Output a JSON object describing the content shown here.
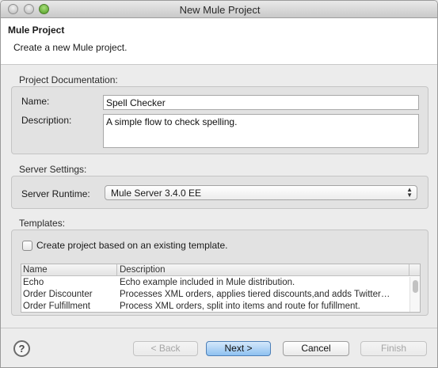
{
  "window": {
    "title": "New Mule Project"
  },
  "header": {
    "title": "Mule Project",
    "description": "Create a new Mule project."
  },
  "documentation": {
    "section_label": "Project Documentation:",
    "name_label": "Name:",
    "name_value": "Spell Checker",
    "description_label": "Description:",
    "description_value": "A simple flow to check spelling."
  },
  "server": {
    "section_label": "Server Settings:",
    "runtime_label": "Server Runtime:",
    "runtime_value": "Mule Server 3.4.0 EE"
  },
  "templates": {
    "section_label": "Templates:",
    "checkbox_label": "Create project based on an existing template.",
    "checkbox_checked": false,
    "columns": [
      "Name",
      "Description"
    ],
    "rows": [
      {
        "name": "Echo",
        "description": "Echo example included in Mule distribution."
      },
      {
        "name": "Order Discounter",
        "description": "Processes XML orders, applies tiered discounts,and adds Twitter…"
      },
      {
        "name": "Order Fulfillment",
        "description": "Process XML orders, split into items and route for fufillment."
      }
    ]
  },
  "footer": {
    "help_glyph": "?",
    "back_label": "< Back",
    "next_label": "Next >",
    "cancel_label": "Cancel",
    "finish_label": "Finish"
  }
}
